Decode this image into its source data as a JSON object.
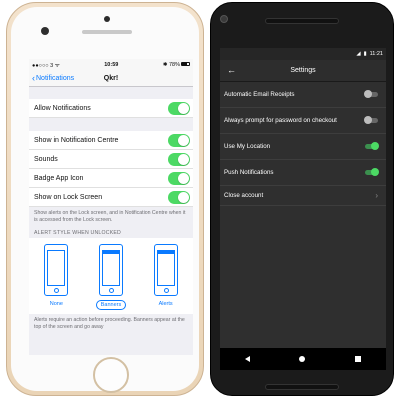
{
  "ios": {
    "status": {
      "carrier": "●●○○○ 3 ᯤ",
      "time": "10:59",
      "battery": "✱ 78%"
    },
    "nav": {
      "back_label": "Notifications",
      "title": "Qkr!"
    },
    "allow_notifications": {
      "label": "Allow Notifications",
      "on": true
    },
    "rows": [
      {
        "label": "Show in Notification Centre",
        "on": true
      },
      {
        "label": "Sounds",
        "on": true
      },
      {
        "label": "Badge App Icon",
        "on": true
      },
      {
        "label": "Show on Lock Screen",
        "on": true
      }
    ],
    "lock_footer": "Show alerts on the Lock screen, and in Notification Centre when it is accessed from the Lock screen.",
    "alert_style_header": "ALERT STYLE WHEN UNLOCKED",
    "alert_styles": [
      {
        "label": "None"
      },
      {
        "label": "Banners",
        "selected": true
      },
      {
        "label": "Alerts"
      }
    ],
    "alert_footer": "Alerts require an action before proceeding. Banners appear at the top of the screen and go away",
    "colors": {
      "accent": "#0a7aff",
      "toggle_on": "#4cd964"
    }
  },
  "android": {
    "status": {
      "time": "11:21"
    },
    "toolbar": {
      "title": "Settings"
    },
    "rows": [
      {
        "label": "Automatic Email Receipts",
        "on": false
      },
      {
        "label": "Always prompt for password on checkout",
        "on": false
      },
      {
        "label": "Use My Location",
        "on": true
      },
      {
        "label": "Push Notifications",
        "on": true
      }
    ],
    "close_account": "Close account",
    "colors": {
      "background": "#2f2f2f",
      "switch_on": "#4cd964"
    }
  }
}
